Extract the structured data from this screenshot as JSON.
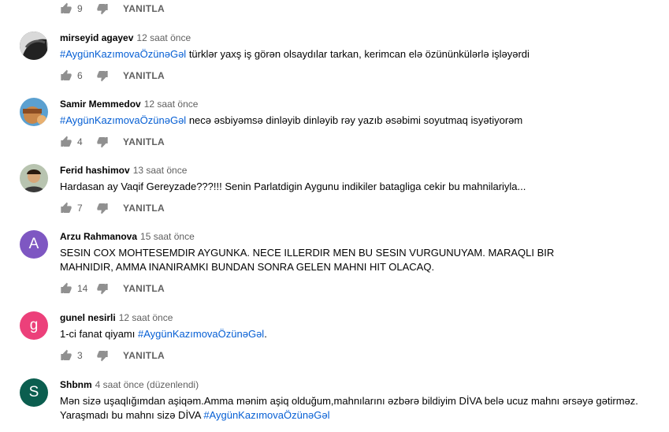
{
  "reply_label": "YANITLA",
  "colors": {
    "hashtag": "#065fd4",
    "avatar_arzu": "#7e57c2",
    "avatar_gunel": "#ec407a",
    "avatar_shbnm": "#0b5e4f"
  },
  "top_actions": {
    "likes": "9"
  },
  "comments": [
    {
      "author": "mirseyid agayev",
      "time": "12 saat önce",
      "hashtag": "#AygünKazımovaÖzünəGəl",
      "text": " türklər yaxş iş görən olsaydılar tarkan, kerimcan elə özününkülərlə işləyərdi",
      "likes": "6"
    },
    {
      "author": "Samir Memmedov",
      "time": "12 saat önce",
      "hashtag": "#AygünKazımovaÖzünəGəl",
      "text": " necə əsbiyəmsə dinləyib dinləyib rəy yazıb əsəbimi soyutmaq isyətiyorəm",
      "likes": "4"
    },
    {
      "author": "Ferid hashimov",
      "time": "13 saat önce",
      "text": "Hardasan ay Vaqif Gereyzade???!!! Senin Parlatdigin Aygunu indikiler batagliga cekir bu mahnilariyla...",
      "likes": "7"
    },
    {
      "author": "Arzu Rahmanova",
      "time": "15 saat önce",
      "initial": "A",
      "text": "SESIN COX MOHTESEMDIR AYGUNKA. NECE ILLERDIR MEN BU SESIN VURGUNUYAM. MARAQLI BIR MAHNIDIR, AMMA INANIRAMKI BUNDAN SONRA GELEN MAHNI HIT OLACAQ.",
      "likes": "14"
    },
    {
      "author": "gunel nesirli",
      "time": "12 saat önce",
      "initial": "g",
      "text_prefix": "1-ci fanat qiyamı ",
      "hashtag": "#AygünKazımovaÖzünəGəl",
      "text_suffix": ".",
      "likes": "3"
    },
    {
      "author": "Shbnm",
      "time": "4 saat önce (düzenlendi)",
      "initial": "S",
      "text_line1": "Mən sizə uşaqlığımdan aşiqəm.Amma mənim aşiq olduğum,mahnılarını əzbərə bildiyim DİVA belə ucuz mahnı ərsəyə gətirməz.",
      "text_line2": "Yaraşmadı bu mahnı sizə DİVA ",
      "hashtag": "#AygünKazımovaÖzünəGəl"
    }
  ]
}
